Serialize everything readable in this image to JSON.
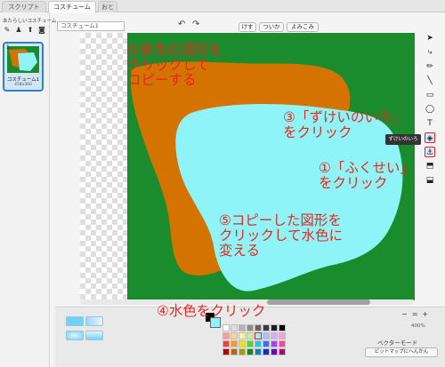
{
  "tabs": [
    {
      "label": "スクリプト"
    },
    {
      "label": "コスチューム"
    },
    {
      "label": "おと"
    }
  ],
  "left": {
    "new_costume_label": "あたらしいコスチューム",
    "costume_item": {
      "number": "1",
      "name": "コスチューム1",
      "size": "458x360"
    }
  },
  "editor": {
    "name_value": "コスチューム1",
    "buttons": {
      "clear": "けす",
      "add": "ついか",
      "import": "よみこみ"
    },
    "tooltip": "ずけいのいろ"
  },
  "annotations": {
    "step2": "②茶色の図形を\nクリックして\nコピーする",
    "step3": "③「ずけいのいろ」\nをクリック",
    "step1": "①「ふくせい」\nをクリック",
    "step5": "⑤コピーした図形を\nクリックして水色に\n変える",
    "step4": "④水色をクリック"
  },
  "bottom": {
    "zoom_minus": "−",
    "zoom_equal": "=",
    "zoom_plus": "+",
    "zoom_pct": "400%",
    "mode_label": "ベクターモード",
    "bitmap_button": "ビットマップにへんかん"
  },
  "colors": {
    "green": "#1a8c2e",
    "brown": "#d57300",
    "aqua": "#8ff4f7",
    "red_text": "#e8271f",
    "selection_blue": "#2e83c7"
  },
  "palette": [
    "#ffffff",
    "#dcdcdc",
    "#b4b4b4",
    "#8c8c8c",
    "#646464",
    "#3c3c3c",
    "#1e1e1e",
    "#000000",
    "#ff9a9a",
    "#ffd08f",
    "#fff49a",
    "#b8f59c",
    "#9af0ff",
    "#a9c2ff",
    "#d6a9ff",
    "#ff9fd8",
    "#ff3b3b",
    "#ff9a1f",
    "#f5e400",
    "#52d62a",
    "#20c9ef",
    "#3f6fff",
    "#a344ff",
    "#ff3fb3",
    "#b80000",
    "#c46200",
    "#a89b00",
    "#0f8a1f",
    "#0086b0",
    "#0d2ecc",
    "#6a00c7",
    "#b3006f"
  ]
}
